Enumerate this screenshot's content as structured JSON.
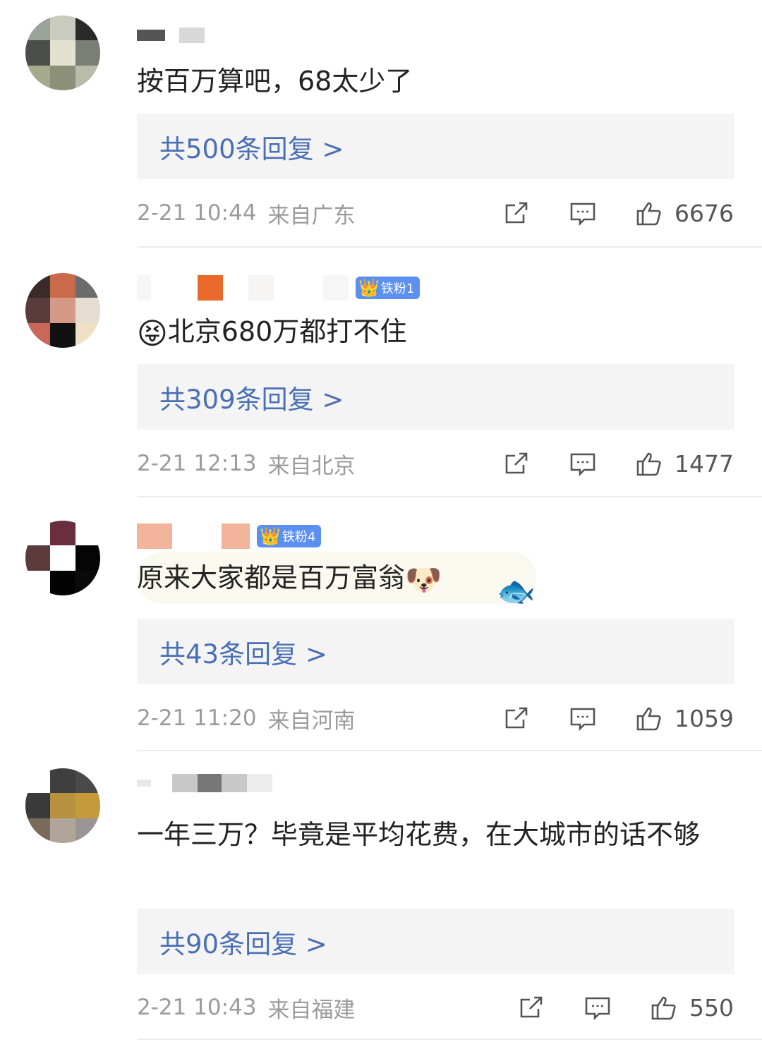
{
  "comments": [
    {
      "text": "按百万算吧，68太少了",
      "replies_label": "共500条回复 >",
      "time": "2-21 10:44",
      "location": "来自广东",
      "likes": "6676"
    },
    {
      "badge": "铁粉1",
      "emoji": "😝",
      "text": "北京680万都打不住",
      "replies_label": "共309条回复 >",
      "time": "2-21 12:13",
      "location": "来自北京",
      "likes": "1477"
    },
    {
      "badge": "铁粉4",
      "text": "原来大家都是百万富翁",
      "emoji": "🐶",
      "replies_label": "共43条回复 >",
      "time": "2-21 11:20",
      "location": "来自河南",
      "likes": "1059"
    },
    {
      "text": "一年三万？毕竟是平均花费，在大城市的话不够",
      "replies_label": "共90条回复 >",
      "time": "2-21 10:43",
      "location": "来自福建",
      "likes": "550"
    }
  ],
  "icons": {
    "share": "share-icon",
    "comment": "comment-icon",
    "like": "thumbs-up-icon",
    "badge": "crown-icon"
  },
  "colors": {
    "reply_link": "#4a6fb5",
    "badge": "#5b8ff0",
    "meta_text": "#9b9b9b"
  }
}
